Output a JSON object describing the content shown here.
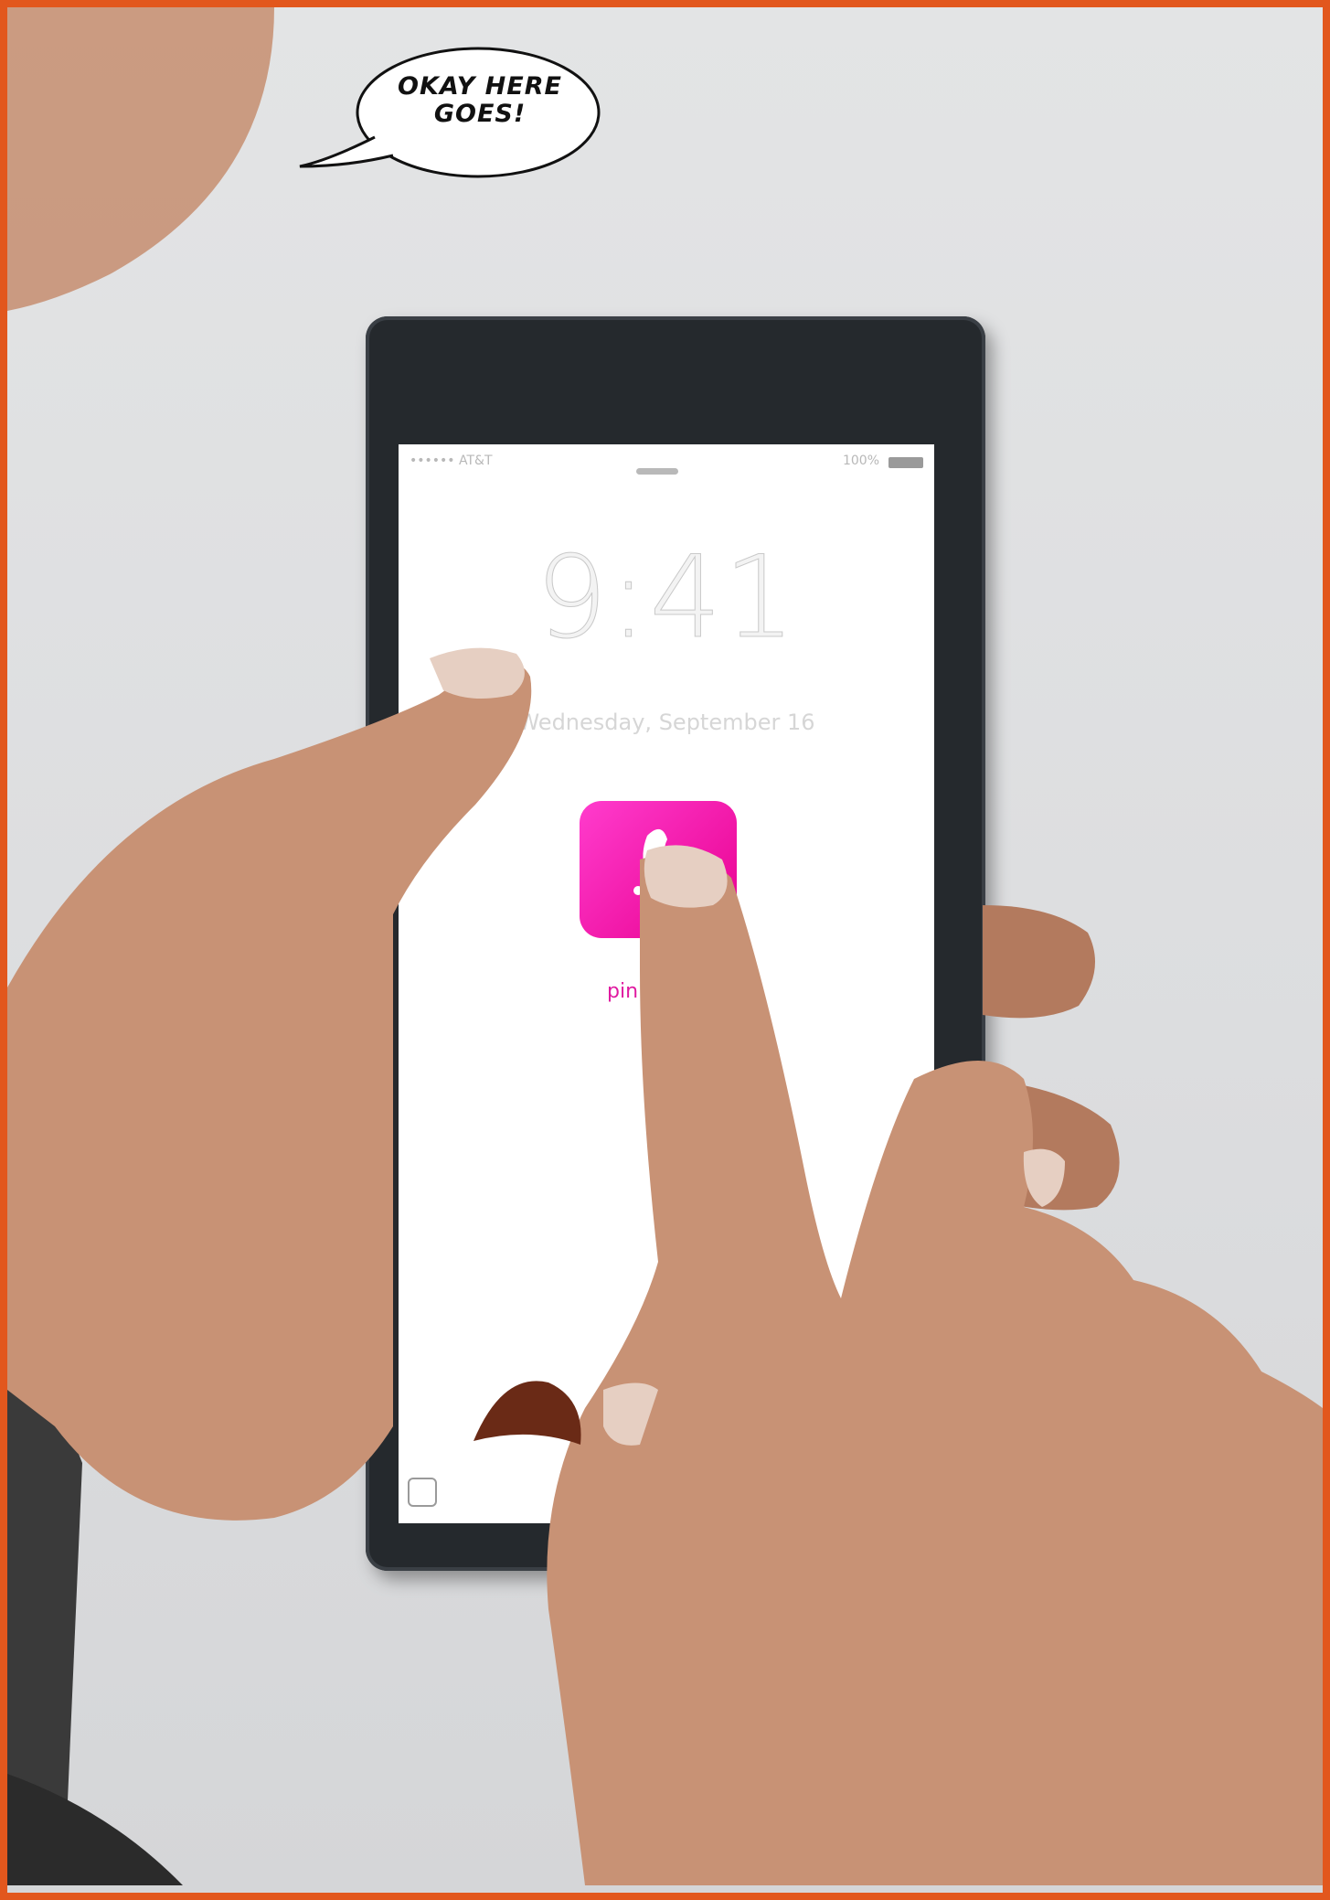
{
  "speech_bubble": {
    "line1": "OKAY HERE",
    "line2": "GOES!"
  },
  "phone": {
    "status_carrier": "•••••• AT&T",
    "status_battery": "100%",
    "clock": "9:41",
    "date": "Wednesday, September 16",
    "app_label": "pin"
  },
  "colors": {
    "panel_border": "#e2571d",
    "app_icon": "#ff1ab8",
    "phone_body": "#25292d"
  },
  "icons": [
    "wifi-icon",
    "battery-icon",
    "app-icon",
    "camera-icon"
  ]
}
